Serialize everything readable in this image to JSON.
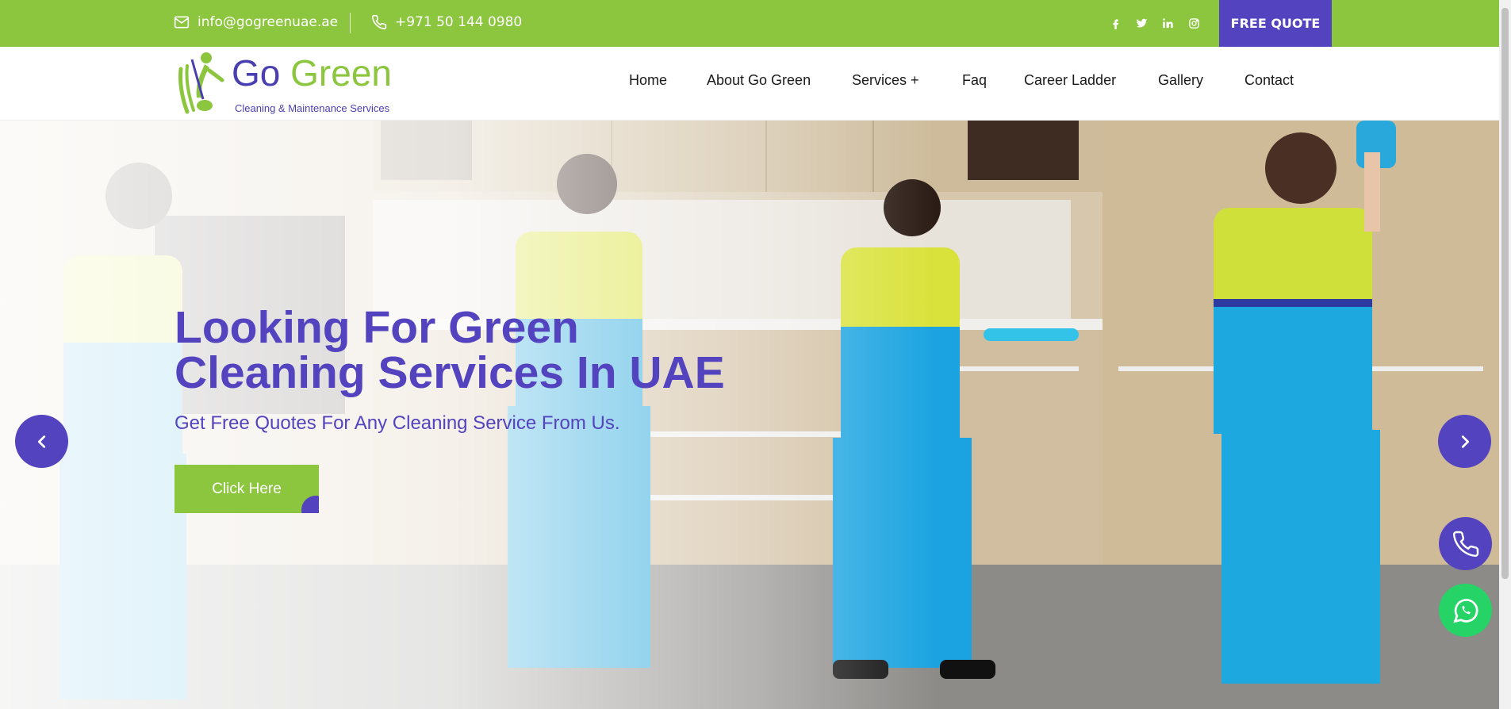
{
  "topbar": {
    "email": "info@gogreenuae.ae",
    "phone": "+971 50 144 0980",
    "socials": [
      "facebook-icon",
      "twitter-icon",
      "linkedin-icon",
      "instagram-icon"
    ],
    "free_quote": "FREE QUOTE"
  },
  "brand": {
    "name_part1": "Go",
    "name_part2": "Green",
    "tagline": "Cleaning & Maintenance Services"
  },
  "nav": {
    "items": [
      "Home",
      "About Go Green",
      "Services +",
      "Faq",
      "Career Ladder",
      "Gallery",
      "Contact"
    ]
  },
  "hero": {
    "title_line1": "Looking For Green",
    "title_line2": "Cleaning Services In UAE",
    "subtitle": "Get Free Quotes For Any Cleaning Service From Us.",
    "button": "Click Here"
  },
  "colors": {
    "green": "#8cc63f",
    "purple": "#5443bf",
    "whatsapp": "#25d366"
  }
}
